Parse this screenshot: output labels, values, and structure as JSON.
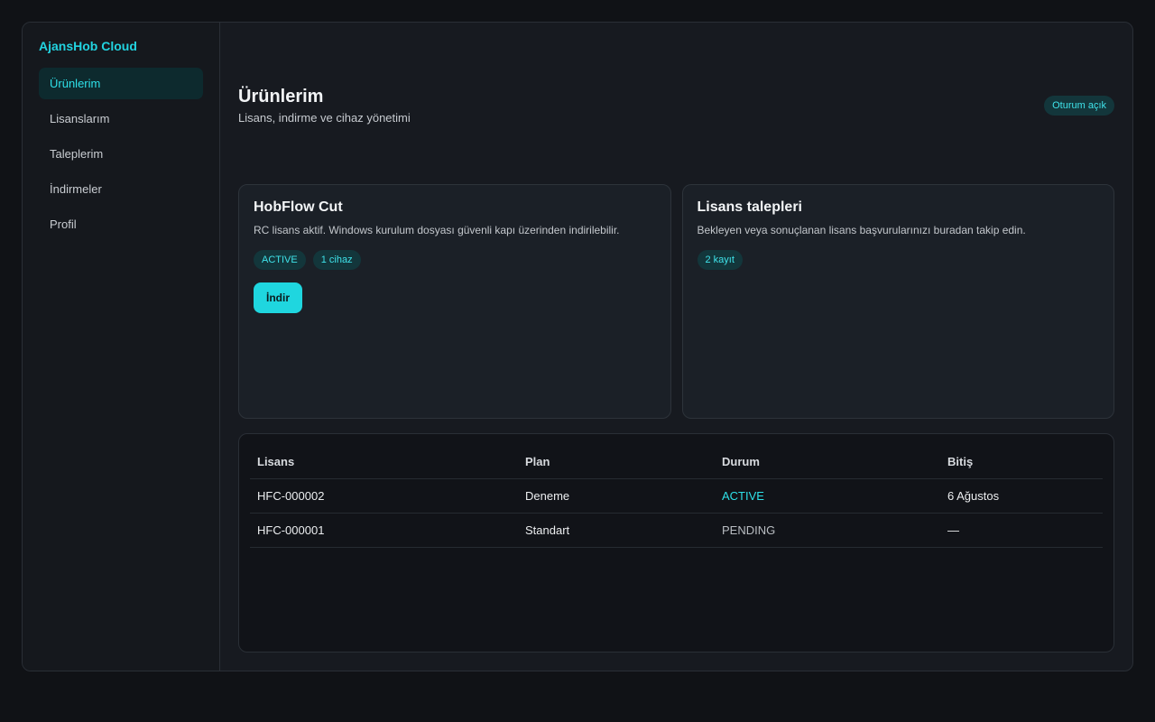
{
  "brand": "AjansHob Cloud",
  "nav": [
    {
      "label": "Ürünlerim"
    },
    {
      "label": "Lisanslarım"
    },
    {
      "label": "Taleplerim"
    },
    {
      "label": "İndirmeler"
    },
    {
      "label": "Profil"
    }
  ],
  "header": {
    "title": "Ürünlerim",
    "subtitle": "Lisans, indirme ve cihaz yönetimi",
    "status": "Oturum açık"
  },
  "product_card": {
    "title": "HobFlow Cut",
    "description": "RC lisans aktif. Windows kurulum dosyası güvenli kapı üzerinden indirilebilir.",
    "badges": [
      "ACTIVE",
      "1 cihaz"
    ],
    "button": "İndir"
  },
  "requests_card": {
    "title": "Lisans talepleri",
    "description": "Bekleyen veya sonuçlanan lisans başvurularınızı buradan takip edin.",
    "badge": "2 kayıt"
  },
  "table": {
    "headers": [
      "Lisans",
      "Plan",
      "Durum",
      "Bitiş"
    ],
    "rows": [
      [
        "HFC-000002",
        "Deneme",
        "ACTIVE",
        "6 Ağustos"
      ],
      [
        "HFC-000001",
        "Standart",
        "PENDING",
        "—"
      ]
    ]
  },
  "colors": {
    "accent": "#1fd6df",
    "background": "#101216",
    "panel": "#171a20"
  }
}
